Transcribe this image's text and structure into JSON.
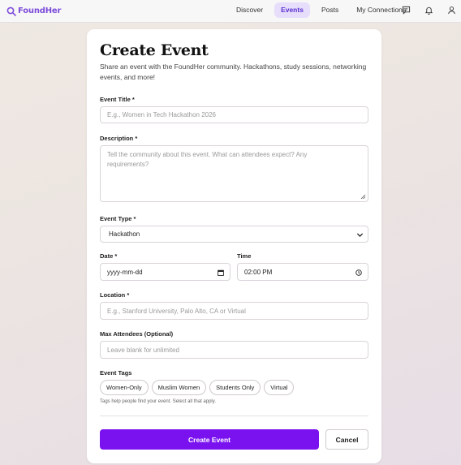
{
  "nav": {
    "brand": "FoundHer",
    "links": [
      {
        "label": "Discover"
      },
      {
        "label": "Events",
        "active": true
      },
      {
        "label": "Posts"
      },
      {
        "label": "My Connections"
      }
    ],
    "icons": [
      "messages-icon",
      "bell-icon",
      "user-icon"
    ]
  },
  "form": {
    "title": "Create Event",
    "subtitle": "Share an event with the FoundHer community. Hackathons, study sessions, networking events, and more!",
    "event_title": {
      "label": "Event Title *",
      "placeholder": "E.g., Women in Tech Hackathon 2026"
    },
    "description": {
      "label": "Description *",
      "placeholder": "Tell the community about this event. What can attendees expect? Any requirements?"
    },
    "event_type": {
      "label": "Event Type *",
      "value": "Hackathon"
    },
    "date": {
      "label": "Date *",
      "placeholder": "yyyy-mm-dd"
    },
    "time": {
      "label": "Time",
      "value": "02:00 PM"
    },
    "location": {
      "label": "Location *",
      "placeholder": "E.g., Stanford University, Palo Alto, CA or Virtual"
    },
    "max_attendees": {
      "label": "Max Attendees (Optional)",
      "placeholder": "Leave blank for unlimited"
    },
    "tags": {
      "label": "Event Tags",
      "options": [
        "Women-Only",
        "Muslim Women",
        "Students Only",
        "Virtual"
      ],
      "hint": "Tags help people find your event. Select all that apply."
    },
    "submit_label": "Create Event",
    "cancel_label": "Cancel"
  },
  "colors": {
    "brand": "#7c4dd9",
    "primary_button": "#7a12f0",
    "active_nav_bg": "#e6defa"
  }
}
